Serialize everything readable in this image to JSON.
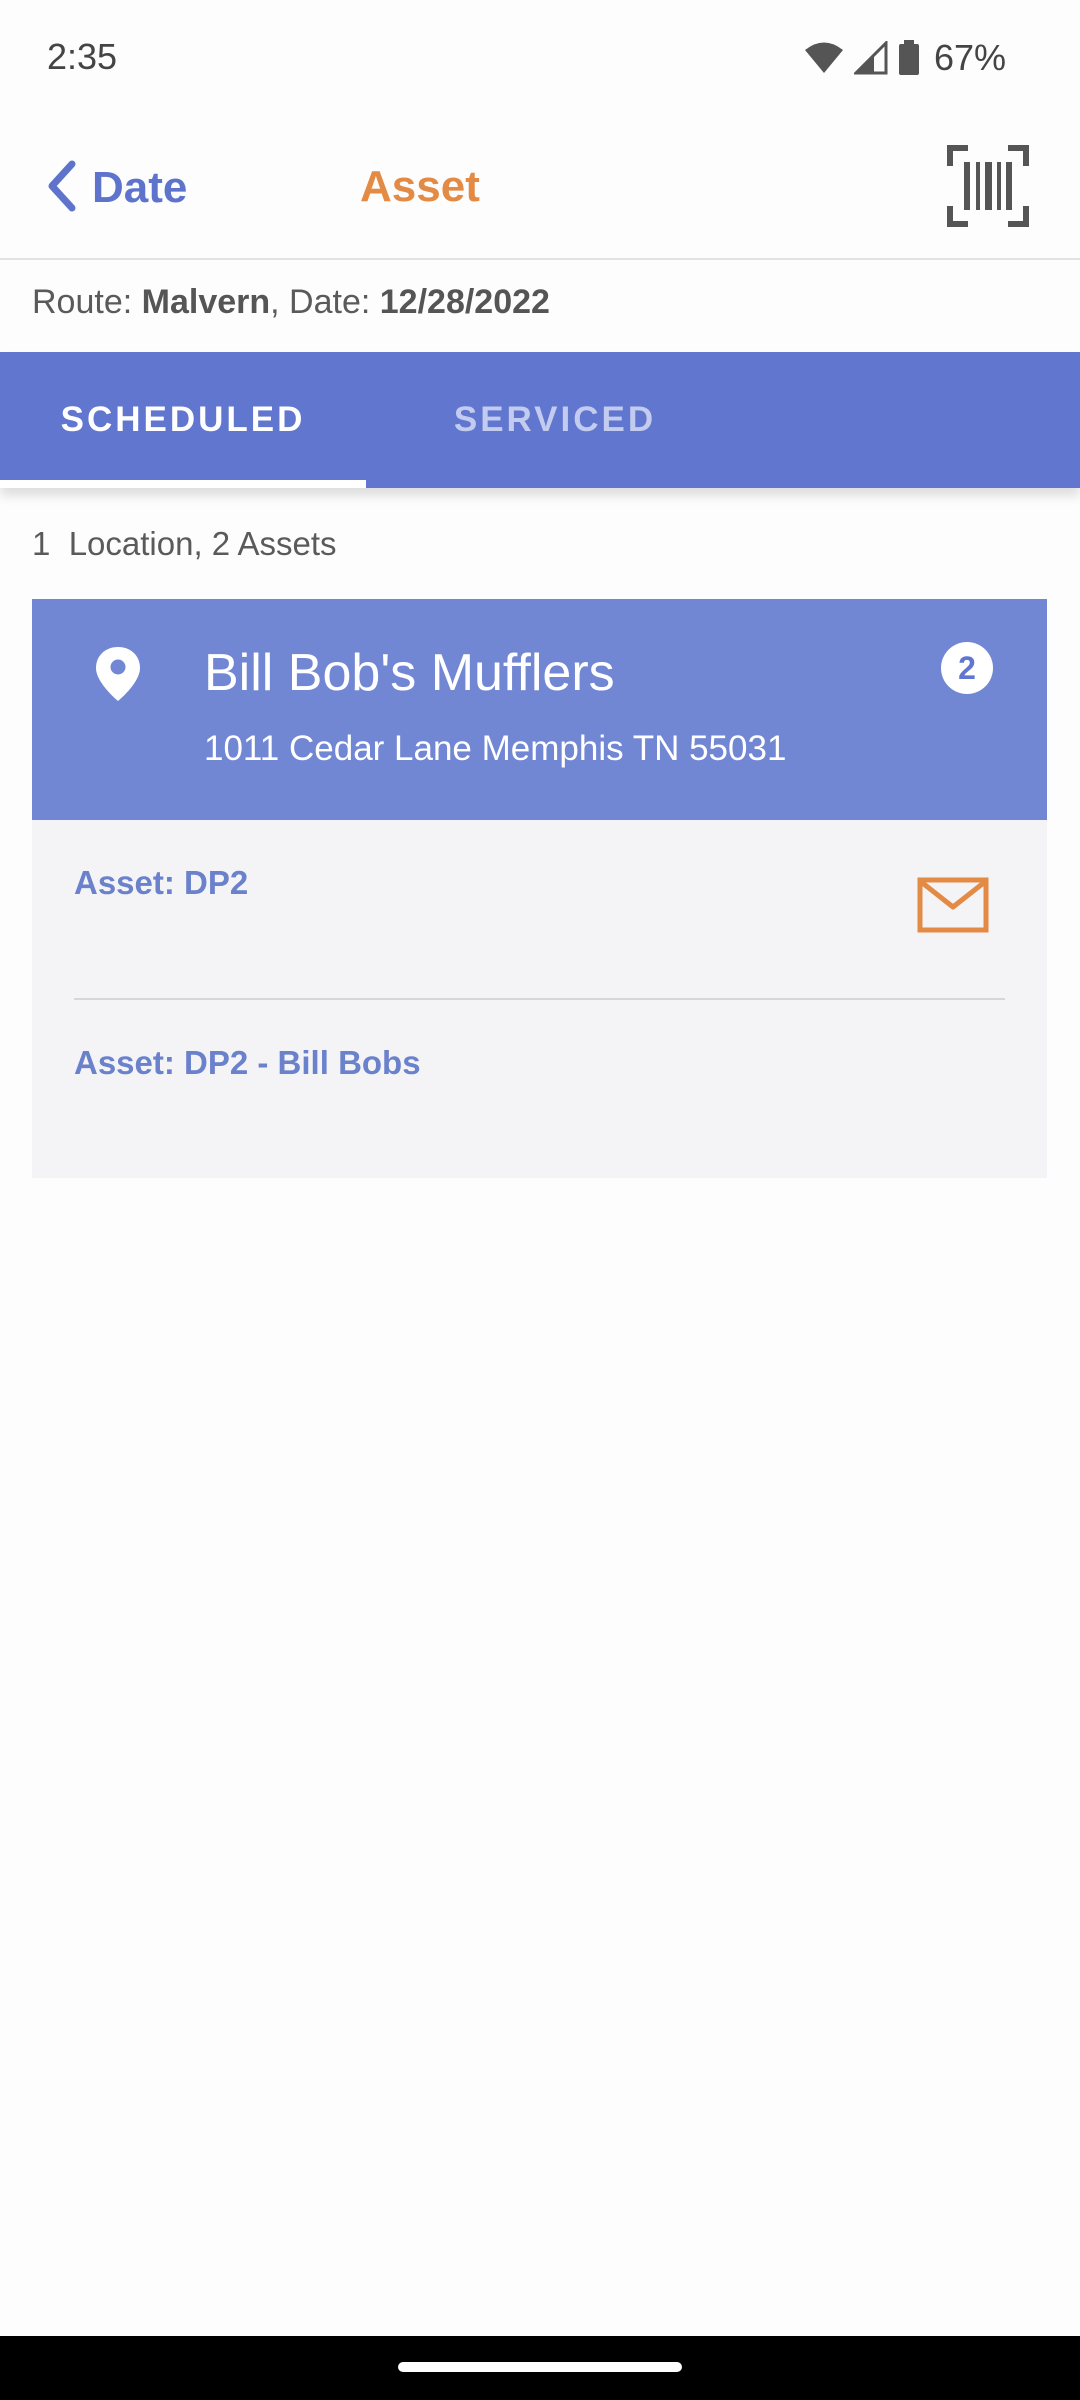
{
  "status_bar": {
    "time": "2:35",
    "battery_percent": "67%",
    "icons": [
      "wifi-icon",
      "cell-signal-icon",
      "battery-icon"
    ]
  },
  "app_bar": {
    "back_label": "Date",
    "title": "Asset",
    "back_icon": "chevron-left-icon",
    "action_icon": "barcode-scan-icon"
  },
  "route": {
    "route_label": "Route:",
    "route_value": "Malvern",
    "date_label": ", Date:",
    "date_value": "12/28/2022"
  },
  "tabs": [
    {
      "label": "SCHEDULED",
      "selected": true
    },
    {
      "label": "SERVICED",
      "selected": false
    }
  ],
  "summary": "1  Location, 2 Assets",
  "location": {
    "name": "Bill Bob's Mufflers",
    "address": "1011 Cedar Lane Memphis TN 55031",
    "asset_count": "2",
    "icon": "map-pin-icon"
  },
  "assets": [
    {
      "label": "Asset: DP2",
      "has_mail": true
    },
    {
      "label": "Asset: DP2 - Bill Bobs",
      "has_mail": false
    }
  ],
  "colors": {
    "primary": "#6176cf",
    "card": "#7287d4",
    "accent": "#e38a45",
    "asset_text": "#6a81cc"
  }
}
